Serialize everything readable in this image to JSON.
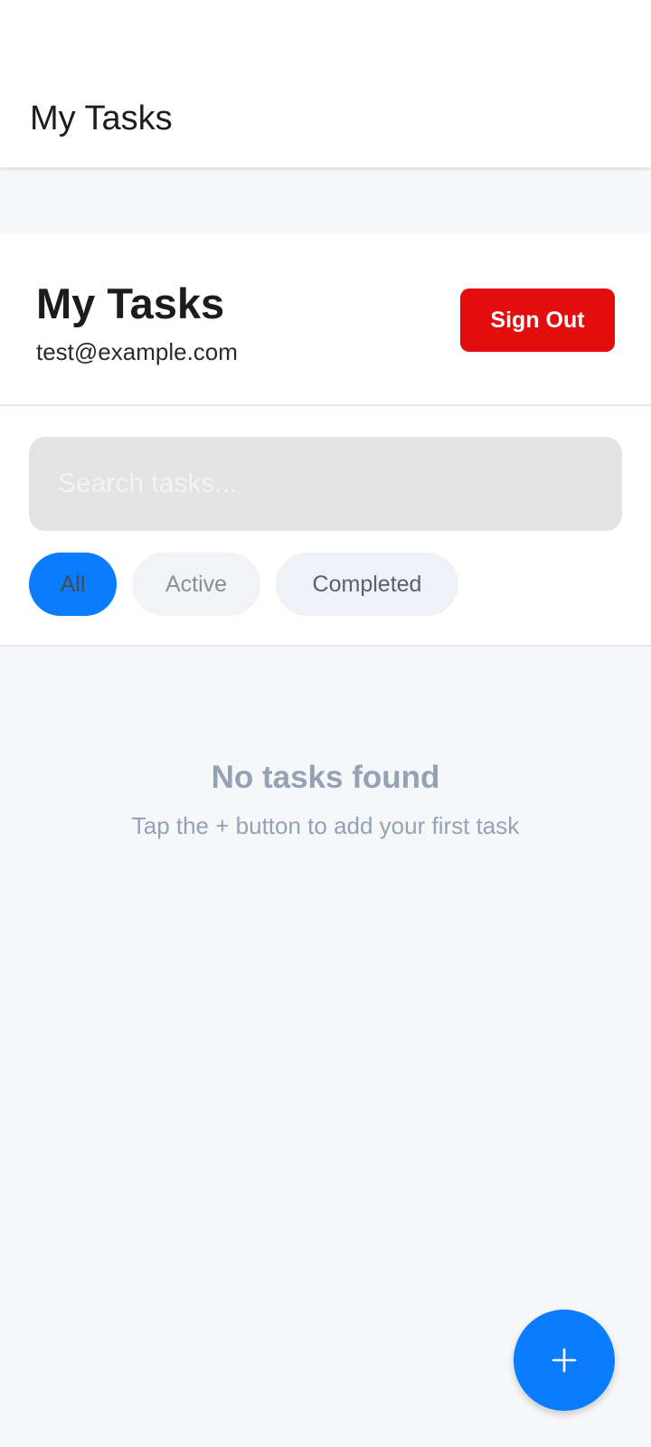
{
  "app_bar": {
    "title": "My Tasks"
  },
  "header": {
    "title": "My Tasks",
    "email": "test@example.com",
    "sign_out_label": "Sign Out"
  },
  "search": {
    "placeholder": "Search tasks..."
  },
  "filters": [
    {
      "label": "All",
      "selected": true
    },
    {
      "label": "Active",
      "selected": false
    },
    {
      "label": "Completed",
      "selected": false
    }
  ],
  "empty_state": {
    "title": "No tasks found",
    "subtitle": "Tap the + button to add your first task"
  },
  "fab": {
    "icon": "plus-icon"
  },
  "colors": {
    "accent": "#0a7cff",
    "danger": "#e30d0d",
    "background": "#f6f7f9",
    "muted_text": "#94a2b6"
  }
}
